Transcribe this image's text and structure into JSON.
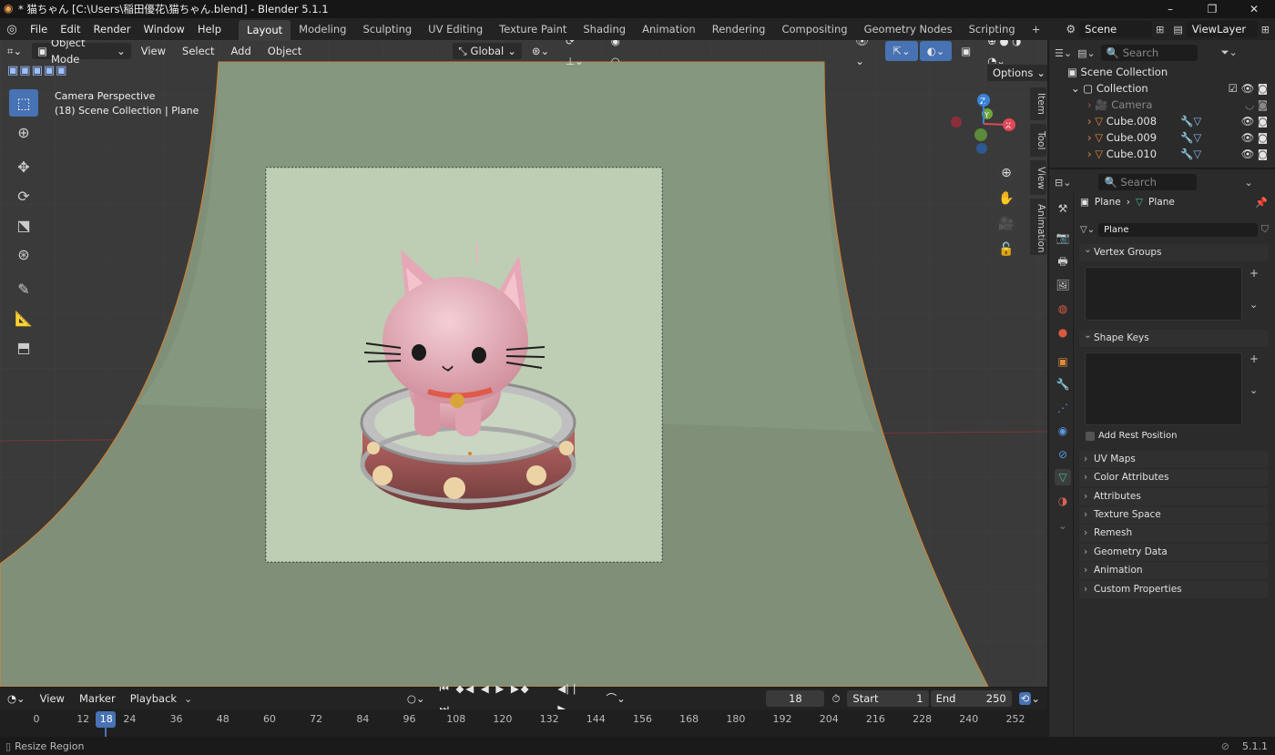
{
  "window": {
    "title": "* 猫ちゃん [C:\\Users\\稲田優花\\猫ちゃん.blend] - Blender 5.1.1"
  },
  "menu": [
    "File",
    "Edit",
    "Render",
    "Window",
    "Help"
  ],
  "workspaces": [
    "Layout",
    "Modeling",
    "Sculpting",
    "UV Editing",
    "Texture Paint",
    "Shading",
    "Animation",
    "Rendering",
    "Compositing",
    "Geometry Nodes",
    "Scripting"
  ],
  "scene": {
    "name": "Scene",
    "view_layer": "ViewLayer"
  },
  "viewport": {
    "mode": "Object Mode",
    "menus": [
      "View",
      "Select",
      "Add",
      "Object"
    ],
    "orientation": "Global",
    "options": "Options",
    "info_line1": "Camera Perspective",
    "info_line2": "(18) Scene Collection | Plane",
    "tabs": [
      "Item",
      "Tool",
      "View",
      "Animation"
    ]
  },
  "outliner": {
    "search_placeholder": "Search",
    "root": "Scene Collection",
    "collection": "Collection",
    "items": [
      "Camera",
      "Cube.008",
      "Cube.009",
      "Cube.010"
    ]
  },
  "properties": {
    "search_placeholder": "Search",
    "breadcrumb_object": "Plane",
    "breadcrumb_data": "Plane",
    "mesh_name": "Plane",
    "panels_open": [
      "Vertex Groups",
      "Shape Keys"
    ],
    "add_rest_position": "Add Rest Position",
    "panels_closed": [
      "UV Maps",
      "Color Attributes",
      "Attributes",
      "Texture Space",
      "Remesh",
      "Geometry Data",
      "Animation",
      "Custom Properties"
    ]
  },
  "timeline": {
    "menus": [
      "View",
      "Marker",
      "Playback"
    ],
    "current_frame": "18",
    "start_label": "Start",
    "start": "1",
    "end_label": "End",
    "end": "250",
    "ticks": [
      "0",
      "12",
      "18",
      "24",
      "36",
      "48",
      "60",
      "72",
      "84",
      "96",
      "108",
      "120",
      "132",
      "144",
      "156",
      "168",
      "180",
      "192",
      "204",
      "216",
      "228",
      "240",
      "252"
    ]
  },
  "status": {
    "hint": "Resize Region",
    "version": "5.1.1"
  }
}
